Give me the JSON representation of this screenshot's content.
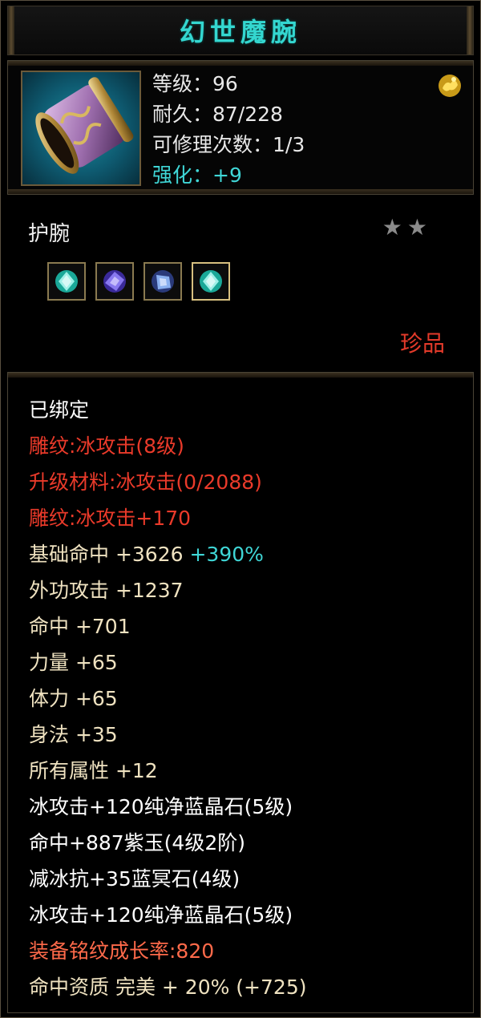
{
  "item": {
    "name": "幻世魔腕",
    "level_line": "等级：96",
    "durability_line": "耐久：87/228",
    "repair_line": "可修理次数：1/3",
    "enhance_line": "强化：+9",
    "type": "护腕",
    "stars": "★★",
    "rarity": "珍品"
  },
  "attributes": [
    {
      "text": "已绑定"
    },
    {
      "text": "雕纹:冰攻击(8级)"
    },
    {
      "text": "升级材料:冰攻击(0/2088)"
    },
    {
      "text": "雕纹:冰攻击+170"
    },
    {
      "text": "基础命中  +3626",
      "extra": "+390%"
    },
    {
      "text": "外功攻击  +1237"
    },
    {
      "text": "命中  +701"
    },
    {
      "text": "力量  +65"
    },
    {
      "text": "体力  +65"
    },
    {
      "text": "身法  +35"
    },
    {
      "text": "所有属性  +12"
    },
    {
      "text": "冰攻击+120纯净蓝晶石(5级)"
    },
    {
      "text": "命中+887紫玉(4级2阶)"
    },
    {
      "text": "减冰抗+35蓝冥石(4级)"
    },
    {
      "text": "冰攻击+120纯净蓝晶石(5级)"
    },
    {
      "text": "装备铭纹成长率:820"
    },
    {
      "text": "命中资质  完美  +  20%  (+725)"
    }
  ],
  "colors": {
    "title": "#34d7d0",
    "enhance": "#3fd6d6",
    "engraving": "#ea3a2a",
    "stat": "#efe2c0",
    "rarity": "#e23a2a"
  }
}
